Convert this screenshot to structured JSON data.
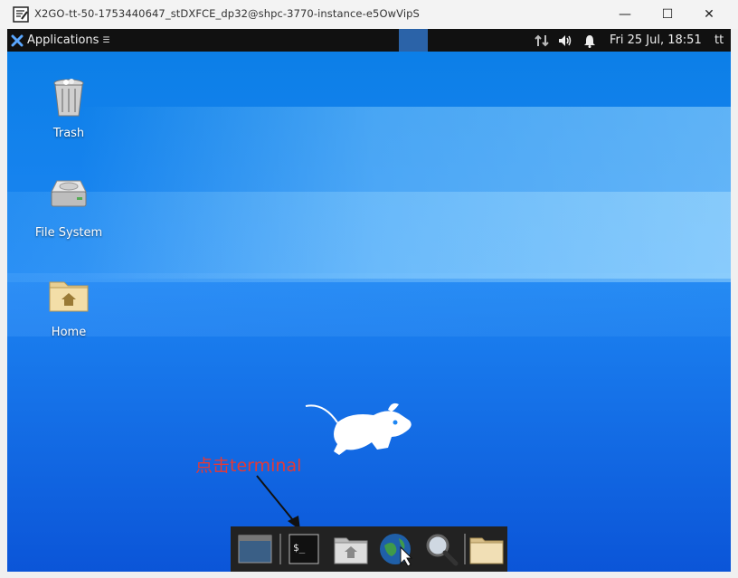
{
  "window": {
    "title": "X2GO-tt-50-1753440647_stDXFCE_dp32@shpc-3770-instance-e5OwVipS",
    "controls": {
      "minimize": "—",
      "maximize": "☐",
      "close": "✕"
    }
  },
  "panel": {
    "applications_label": "Applications",
    "applications_suffix": "☰",
    "clock": "Fri 25 Jul, 18:51",
    "user": "tt"
  },
  "desktop": {
    "icons": [
      {
        "label": "Trash",
        "icon": "trash-icon"
      },
      {
        "label": "File System",
        "icon": "hard-drive-icon"
      },
      {
        "label": "Home",
        "icon": "home-folder-icon"
      }
    ]
  },
  "annotation": {
    "text": "点击terminal",
    "color": "#e53935"
  },
  "dock": {
    "items": [
      "show-desktop-icon",
      "terminal-icon",
      "home-folder-icon",
      "web-browser-icon",
      "search-icon",
      "folder-icon"
    ]
  },
  "colors": {
    "panel": "#111111",
    "accent": "#2b63a8",
    "desktop": "#1d86f3"
  }
}
